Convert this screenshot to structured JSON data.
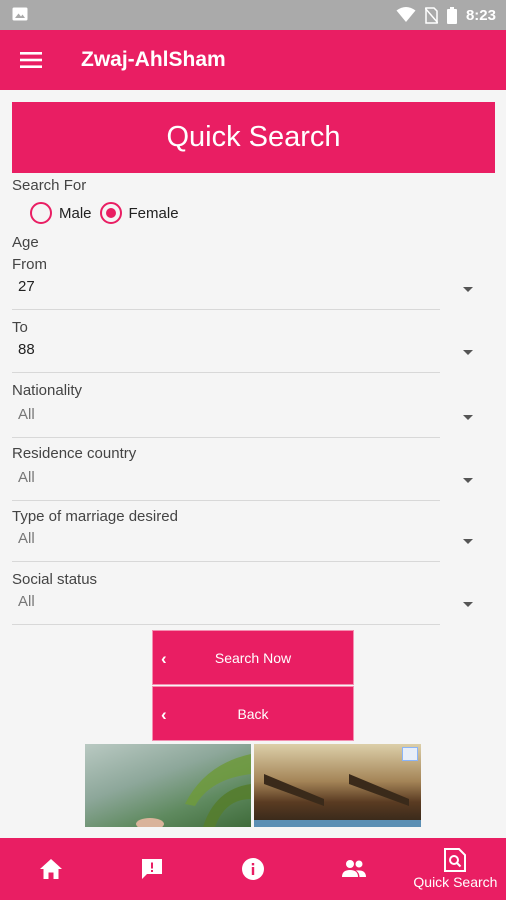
{
  "status_bar": {
    "time": "8:23"
  },
  "app_bar": {
    "title": "Zwaj-AhlSham"
  },
  "banner": {
    "title": "Quick Search"
  },
  "form": {
    "search_for_label": "Search For",
    "gender_options": [
      {
        "label": "Male",
        "checked": false
      },
      {
        "label": "Female",
        "checked": true
      }
    ],
    "age_label": "Age",
    "from_label": "From",
    "from_value": "27",
    "to_label": "To",
    "to_value": "88",
    "nationality_label": "Nationality",
    "nationality_value": "All",
    "residence_label": "Residence country",
    "residence_value": "All",
    "marriage_type_label": "Type of marriage desired",
    "marriage_type_value": "All",
    "social_status_label": "Social status",
    "social_status_value": "All"
  },
  "actions": {
    "search_now": "Search Now",
    "back": "Back"
  },
  "bottom_nav": {
    "items": [
      {
        "icon": "home-icon",
        "label": ""
      },
      {
        "icon": "feedback-icon",
        "label": ""
      },
      {
        "icon": "info-icon",
        "label": ""
      },
      {
        "icon": "people-icon",
        "label": ""
      },
      {
        "icon": "quick-search-icon",
        "label": "Quick Search"
      }
    ]
  },
  "colors": {
    "primary": "#e91e63",
    "status_bar": "#aaaaaa",
    "background": "#f5f5f5"
  }
}
